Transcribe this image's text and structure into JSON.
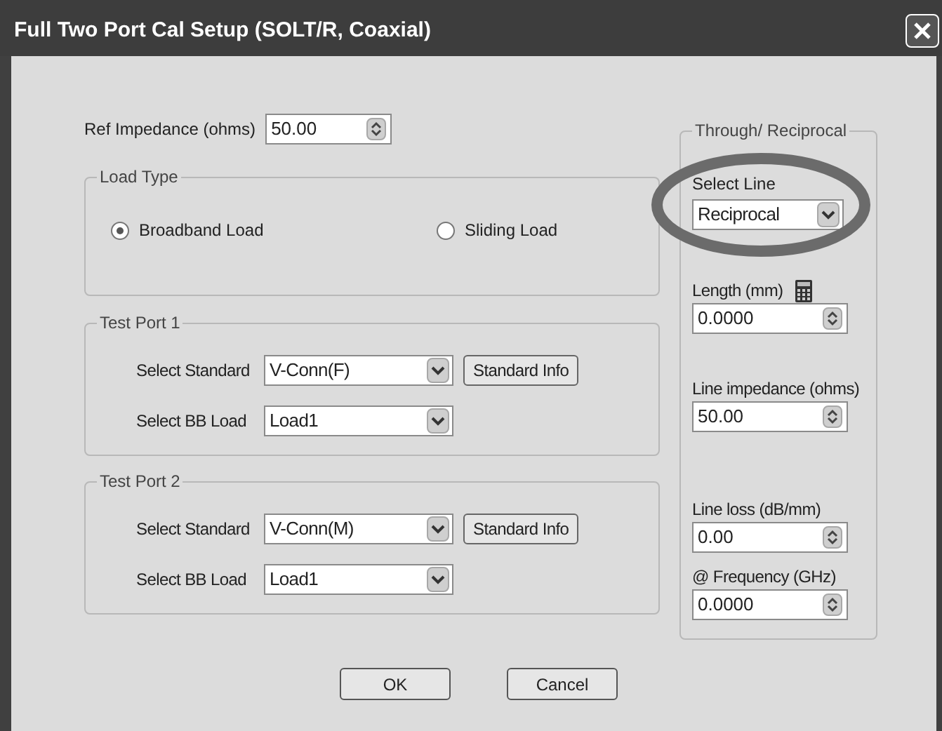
{
  "window": {
    "title": "Full Two Port Cal Setup (SOLT/R, Coaxial)"
  },
  "ref_impedance": {
    "label": "Ref Impedance (ohms)",
    "value": "50.00"
  },
  "load_type": {
    "title": "Load Type",
    "options": [
      {
        "label": "Broadband Load",
        "selected": true
      },
      {
        "label": "Sliding Load",
        "selected": false
      }
    ]
  },
  "test_ports": [
    {
      "title": "Test Port 1",
      "rows": [
        {
          "label": "Select Standard",
          "value": "V-Conn(F)",
          "button": "Standard Info"
        },
        {
          "label": "Select BB Load",
          "value": "Load1"
        }
      ]
    },
    {
      "title": "Test Port 2",
      "rows": [
        {
          "label": "Select Standard",
          "value": "V-Conn(M)",
          "button": "Standard Info"
        },
        {
          "label": "Select BB Load",
          "value": "Load1"
        }
      ]
    }
  ],
  "through_reciprocal": {
    "title": "Through/ Reciprocal",
    "select_line": {
      "label": "Select Line",
      "value": "Reciprocal",
      "highlighted": true
    },
    "fields": [
      {
        "kind": "calc",
        "label": "Length (mm)",
        "value": "0.0000"
      },
      {
        "kind": "spin",
        "label": "Line impedance (ohms)",
        "value": "50.00"
      },
      {
        "kind": "spin",
        "label": "Line loss (dB/mm)",
        "value": "0.00"
      },
      {
        "kind": "spin",
        "label": "@ Frequency (GHz)",
        "value": "0.0000"
      }
    ]
  },
  "buttons": [
    "OK",
    "Cancel"
  ]
}
